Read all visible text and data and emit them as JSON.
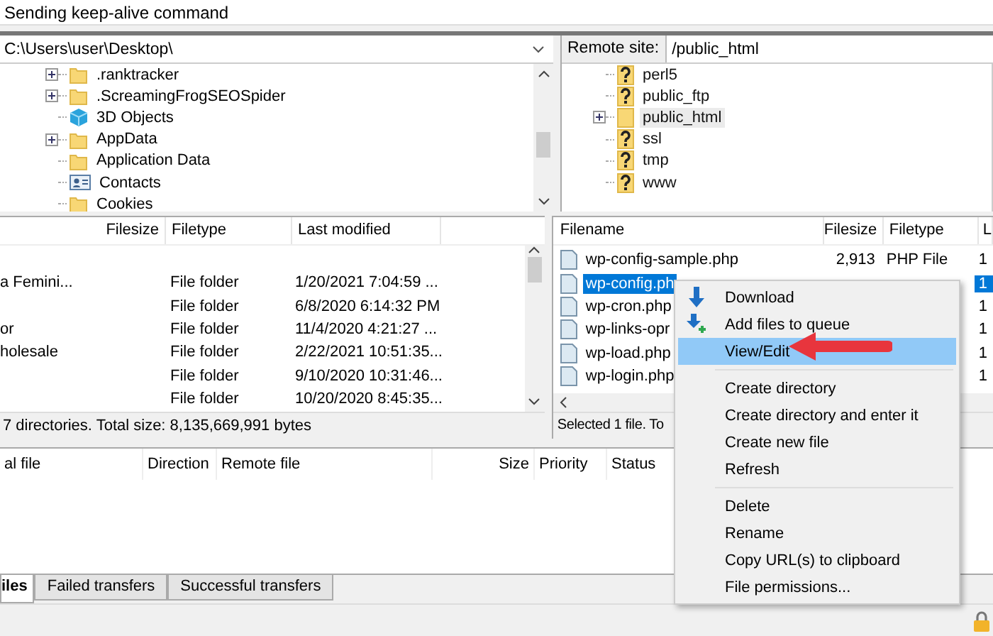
{
  "message_log": {
    "lines": [
      "Sending keep-alive command"
    ]
  },
  "local_site": {
    "path": "C:\\Users\\user\\Desktop\\",
    "tree": [
      {
        "label": ".ranktracker",
        "kind": "folder",
        "expandable": true
      },
      {
        "label": ".ScreamingFrogSEOSpider",
        "kind": "folder",
        "expandable": true
      },
      {
        "label": "3D Objects",
        "kind": "cube",
        "expandable": false
      },
      {
        "label": "AppData",
        "kind": "folder",
        "expandable": true
      },
      {
        "label": "Application Data",
        "kind": "folder",
        "expandable": false
      },
      {
        "label": "Contacts",
        "kind": "contacts",
        "expandable": false
      },
      {
        "label": "Cookies",
        "kind": "folder",
        "expandable": false
      }
    ]
  },
  "remote_site": {
    "label": "Remote site:",
    "path": "/public_html",
    "tree": [
      {
        "label": "perl5",
        "kind": "unknown",
        "expandable": false,
        "selected": false
      },
      {
        "label": "public_ftp",
        "kind": "unknown",
        "expandable": false,
        "selected": false
      },
      {
        "label": "public_html",
        "kind": "folder",
        "expandable": true,
        "selected": true
      },
      {
        "label": "ssl",
        "kind": "unknown",
        "expandable": false,
        "selected": false
      },
      {
        "label": "tmp",
        "kind": "unknown",
        "expandable": false,
        "selected": false
      },
      {
        "label": "www",
        "kind": "unknown",
        "expandable": false,
        "selected": false
      }
    ]
  },
  "local_files": {
    "columns": [
      "Filesize",
      "Filetype",
      "Last modified"
    ],
    "rows": [
      {
        "name": "a Femini...",
        "filetype": "File folder",
        "last_modified": "1/20/2021 7:04:59 ..."
      },
      {
        "filetype": "File folder",
        "last_modified": "6/8/2020 6:14:32 PM"
      },
      {
        "name": "or",
        "filetype": "File folder",
        "last_modified": "11/4/2020 4:21:27 ..."
      },
      {
        "name": "holesale",
        "filetype": "File folder",
        "last_modified": "2/22/2021 10:51:35..."
      },
      {
        "filetype": "File folder",
        "last_modified": "9/10/2020 10:31:46..."
      },
      {
        "filetype": "File folder",
        "last_modified": "10/20/2020 8:45:35..."
      }
    ],
    "status": "7 directories. Total size: 8,135,669,991 bytes"
  },
  "remote_files": {
    "columns": [
      "Filename",
      "Filesize",
      "Filetype",
      "L"
    ],
    "rows": [
      {
        "name": "wp-config-sample.php",
        "filesize": "2,913",
        "filetype": "PHP File",
        "last_modified": "1",
        "selected": false
      },
      {
        "name": "wp-config.ph",
        "last_modified": "1",
        "selected": true
      },
      {
        "name": "wp-cron.php",
        "last_modified": "1",
        "selected": false
      },
      {
        "name": "wp-links-opr",
        "last_modified": "1",
        "selected": false
      },
      {
        "name": "wp-load.php",
        "last_modified": "1",
        "selected": false
      },
      {
        "name": "wp-login.php",
        "last_modified": "1",
        "selected": false
      }
    ],
    "status": "Selected 1 file. To"
  },
  "context_menu": {
    "items": [
      {
        "kind": "download",
        "label": "Download",
        "selected": false
      },
      {
        "kind": "queue",
        "label": "Add files to queue",
        "selected": false
      },
      {
        "kind": "item",
        "label": "View/Edit",
        "selected": true
      },
      {
        "kind": "separator"
      },
      {
        "kind": "item",
        "label": "Create directory",
        "selected": false
      },
      {
        "kind": "item",
        "label": "Create directory and enter it",
        "selected": false
      },
      {
        "kind": "item",
        "label": "Create new file",
        "selected": false
      },
      {
        "kind": "item",
        "label": "Refresh",
        "selected": false
      },
      {
        "kind": "separator"
      },
      {
        "kind": "item",
        "label": "Delete",
        "selected": false
      },
      {
        "kind": "item",
        "label": "Rename",
        "selected": false
      },
      {
        "kind": "item",
        "label": "Copy URL(s) to clipboard",
        "selected": false
      },
      {
        "kind": "item",
        "label": "File permissions...",
        "selected": false
      }
    ]
  },
  "queue": {
    "columns": [
      "al file",
      "Direction",
      "Remote file",
      "Size",
      "Priority",
      "Status"
    ]
  },
  "queue_tabs": [
    {
      "label": "iles",
      "selected": true
    },
    {
      "label": "Failed transfers",
      "selected": false
    },
    {
      "label": "Successful transfers",
      "selected": false
    }
  ]
}
